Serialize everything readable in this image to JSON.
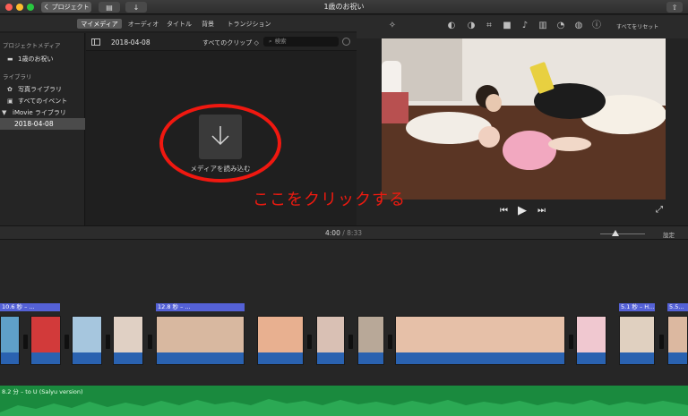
{
  "titlebar": {
    "project_button": "く プロジェクト",
    "title": "1歳のお祝い"
  },
  "tabs": [
    "マイメディア",
    "オーディオ",
    "タイトル",
    "背景",
    "トランジション"
  ],
  "viewer_toolbar": {
    "reset_label": "すべてをリセット"
  },
  "sidebar": {
    "project_media_heading": "プロジェクトメディア",
    "project_item": "1歳のお祝い",
    "library_heading": "ライブラリ",
    "photo_library": "写真ライブラリ",
    "all_events": "すべてのイベント",
    "imovie_library": "iMovie ライブラリ",
    "selected_event": "2018-04-08"
  },
  "browser": {
    "event_date": "2018-04-08",
    "filter": "すべてのクリップ ◇",
    "search_placeholder": "検索",
    "import_label": "メディアを読み込む"
  },
  "annotation": "ここをクリックする",
  "timeline": {
    "current_time": "4:00",
    "total_time": "8:33",
    "settings_label": "設定",
    "clip_labels": [
      "10.6 秒 – ...",
      "12.8 秒 – ...",
      "5.1 秒 – H...",
      "5.5..."
    ],
    "music_label": "8.2 分 – to U (Salyu version)"
  },
  "colors": {
    "annotation_red": "#ee1a10",
    "clip_label_blue": "#5461d6",
    "audio_blue": "#2a62b0",
    "music_green": "#1a8a3e"
  }
}
